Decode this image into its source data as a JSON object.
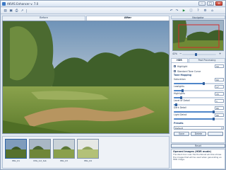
{
  "window": {
    "title": "AKVIS Enhancer v. 7.0",
    "controls": {
      "minimize": "–",
      "maximize": "□",
      "close": "✕"
    }
  },
  "toolbar": {
    "left_icons": [
      "open-icon",
      "save-icon",
      "print-icon",
      "share-icon"
    ],
    "right_icons": [
      "undo-icon",
      "redo-icon",
      "run-icon",
      "info-icon",
      "help-icon",
      "settings-icon",
      "home-icon"
    ]
  },
  "view_tabs": {
    "before": "Before",
    "after": "After"
  },
  "navigator": {
    "title": "Navigator",
    "zoom": "42%"
  },
  "panel_tabs": {
    "hdr": "HDR",
    "post": "Post Processing"
  },
  "settings": {
    "highlight_label": "Highlight",
    "highlight_value": "50",
    "standard_tone_curve": "Standard Tone Curve",
    "tone_mapping": "Tone Mapping",
    "rows": [
      {
        "label": "Saturation",
        "value": "60",
        "level": 0.6
      },
      {
        "label": "Lowlights",
        "value": "17",
        "level": 0.17
      },
      {
        "label": "Highlights",
        "value": "15",
        "level": 0.15
      },
      {
        "label": "Level of Detail",
        "value": "1",
        "level": 0.05
      },
      {
        "label": "Dark Detail",
        "value": "80",
        "level": 0.8
      },
      {
        "label": "Light Detail",
        "value": "80",
        "level": 0.8
      }
    ],
    "presets_label": "Presets",
    "preset_value": "Default",
    "save_button": "Save",
    "delete_button": "Delete",
    "reset_button": "Reset"
  },
  "help": {
    "title": "Opened Images (HDR mode)",
    "text": "The stack box near the thumbnail window shows the images that will be used when generating an HDR image."
  },
  "thumbnails": [
    {
      "caption": "IMG_01"
    },
    {
      "caption": "IMG_lod_tab"
    },
    {
      "caption": "IMG_03"
    },
    {
      "caption": "IMG_04"
    }
  ]
}
